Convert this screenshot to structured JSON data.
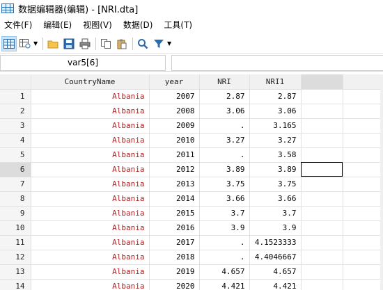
{
  "window": {
    "title": "数据编辑器(编辑) - [NRI.dta]"
  },
  "menu": [
    {
      "label": "文件(F)"
    },
    {
      "label": "编辑(E)"
    },
    {
      "label": "视图(V)"
    },
    {
      "label": "数据(D)"
    },
    {
      "label": "工具(T)"
    }
  ],
  "toolbar": {
    "icons": [
      "edit-mode-icon",
      "browse-mode-icon",
      "open-folder-icon",
      "save-icon",
      "print-icon",
      "copy-icon",
      "paste-icon",
      "search-icon",
      "filter-icon"
    ]
  },
  "formula_bar": {
    "variable_ref": "var5[6]",
    "value": ""
  },
  "table": {
    "columns": [
      "CountryName",
      "year",
      "NRI",
      "NRI1"
    ],
    "selected_row": 6,
    "rows": [
      {
        "n": "1",
        "country": "Albania",
        "year": "2007",
        "nri": "2.87",
        "nri1": "2.87"
      },
      {
        "n": "2",
        "country": "Albania",
        "year": "2008",
        "nri": "3.06",
        "nri1": "3.06"
      },
      {
        "n": "3",
        "country": "Albania",
        "year": "2009",
        "nri": ".",
        "nri1": "3.165"
      },
      {
        "n": "4",
        "country": "Albania",
        "year": "2010",
        "nri": "3.27",
        "nri1": "3.27"
      },
      {
        "n": "5",
        "country": "Albania",
        "year": "2011",
        "nri": ".",
        "nri1": "3.58"
      },
      {
        "n": "6",
        "country": "Albania",
        "year": "2012",
        "nri": "3.89",
        "nri1": "3.89"
      },
      {
        "n": "7",
        "country": "Albania",
        "year": "2013",
        "nri": "3.75",
        "nri1": "3.75"
      },
      {
        "n": "8",
        "country": "Albania",
        "year": "2014",
        "nri": "3.66",
        "nri1": "3.66"
      },
      {
        "n": "9",
        "country": "Albania",
        "year": "2015",
        "nri": "3.7",
        "nri1": "3.7"
      },
      {
        "n": "10",
        "country": "Albania",
        "year": "2016",
        "nri": "3.9",
        "nri1": "3.9"
      },
      {
        "n": "11",
        "country": "Albania",
        "year": "2017",
        "nri": ".",
        "nri1": "4.1523333"
      },
      {
        "n": "12",
        "country": "Albania",
        "year": "2018",
        "nri": ".",
        "nri1": "4.4046667"
      },
      {
        "n": "13",
        "country": "Albania",
        "year": "2019",
        "nri": "4.657",
        "nri1": "4.657"
      },
      {
        "n": "14",
        "country": "Albania",
        "year": "2020",
        "nri": "4.421",
        "nri1": "4.421"
      }
    ]
  },
  "colors": {
    "string_value": "#b22222",
    "selected_header": "#dcdcdc",
    "active_tool": "#cce4f7"
  }
}
